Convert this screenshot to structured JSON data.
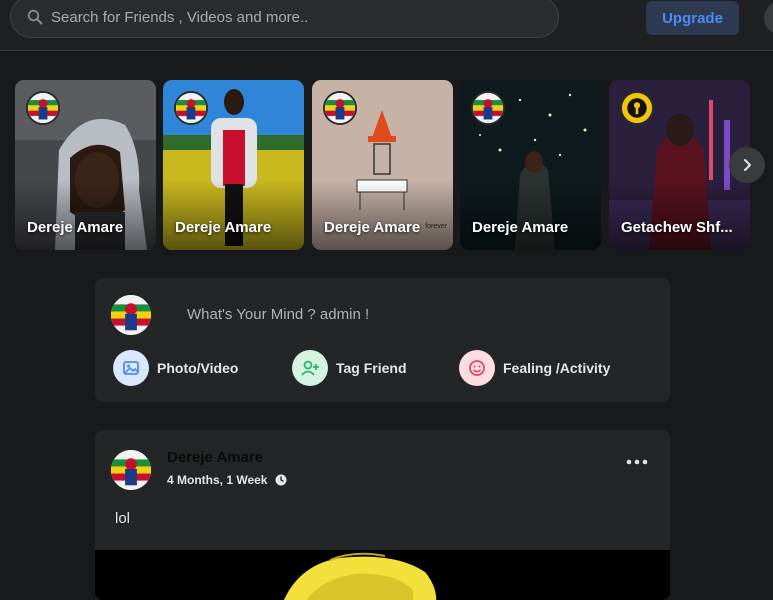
{
  "search": {
    "placeholder": "Search for Friends , Videos and more.."
  },
  "topbar": {
    "upgrade_label": "Upgrade"
  },
  "stories": [
    {
      "name": "Dereje Amare"
    },
    {
      "name": "Dereje Amare"
    },
    {
      "name": "Dereje Amare",
      "caption": "forever"
    },
    {
      "name": "Dereje Amare"
    },
    {
      "name": "Getachew Shf..."
    }
  ],
  "composer": {
    "prompt": "What's Your Mind ? admin !",
    "actions": [
      {
        "label": "Photo/Video",
        "icon": "photo-icon",
        "color": "#4c8bf5",
        "bg": "#dbe7fd"
      },
      {
        "label": "Tag Friend",
        "icon": "add-user-icon",
        "color": "#2fb36b",
        "bg": "#d4f3e2"
      },
      {
        "label": "Fealing /Activity",
        "icon": "smiley-icon",
        "color": "#e8465b",
        "bg": "#fbdde2"
      }
    ]
  },
  "post": {
    "author": "Dereje Amare",
    "time": "4 Months, 1 Week",
    "text": "lol"
  },
  "colors": {
    "accent": "#4c8bf5",
    "background": "#18191a",
    "card": "#242526"
  }
}
